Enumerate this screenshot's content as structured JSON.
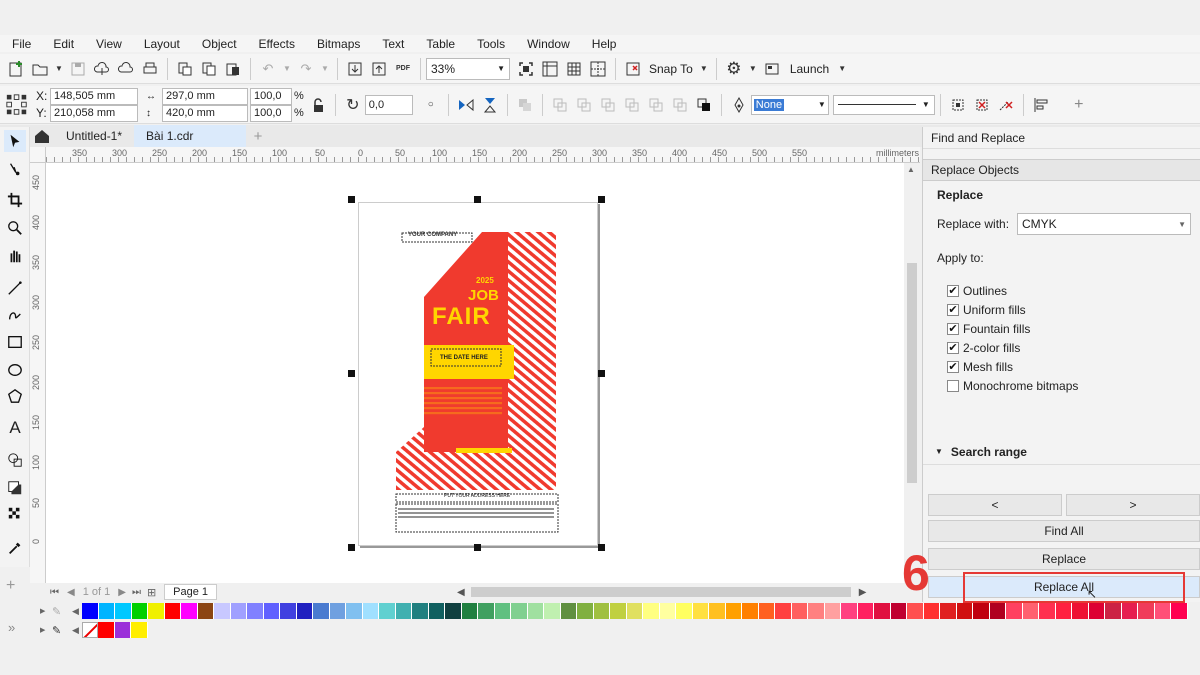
{
  "menu": [
    "File",
    "Edit",
    "View",
    "Layout",
    "Object",
    "Effects",
    "Bitmaps",
    "Text",
    "Table",
    "Tools",
    "Window",
    "Help"
  ],
  "standard_toolbar": {
    "zoom": "33%",
    "snap_to": "Snap To",
    "launch": "Launch"
  },
  "property_bar": {
    "x": "148,505 mm",
    "y": "210,058 mm",
    "width": "297,0 mm",
    "height": "420,0 mm",
    "scale_w": "100,0",
    "scale_h": "100,0",
    "pct": "%",
    "rotation": "0,0",
    "fill": "None",
    "x_label": "X:",
    "y_label": "Y:"
  },
  "tabs": [
    {
      "label": "Untitled-1*"
    },
    {
      "label": "Bài 1.cdr"
    }
  ],
  "ruler": {
    "h_ticks": [
      "350",
      "300",
      "250",
      "200",
      "150",
      "100",
      "50",
      "0",
      "50",
      "100",
      "150",
      "200",
      "250",
      "300",
      "350",
      "400",
      "450",
      "500",
      "550"
    ],
    "units": "millimeters",
    "v_ticks": [
      "450",
      "400",
      "350",
      "300",
      "250",
      "200",
      "150",
      "100",
      "50",
      "0"
    ]
  },
  "page_nav": {
    "of": "1 of 1",
    "page": "Page 1"
  },
  "panel": {
    "title": "Find and Replace",
    "section": "Replace Objects",
    "sub": "Replace",
    "replace_with_label": "Replace with:",
    "replace_with_value": "CMYK",
    "apply_to": "Apply to:",
    "options": [
      {
        "label": "Outlines",
        "checked": true
      },
      {
        "label": "Uniform fills",
        "checked": true
      },
      {
        "label": "Fountain fills",
        "checked": true
      },
      {
        "label": "2-color fills",
        "checked": true
      },
      {
        "label": "Mesh fills",
        "checked": true
      },
      {
        "label": "Monochrome bitmaps",
        "checked": false
      }
    ],
    "search_range": "Search range",
    "prev": "<",
    "next": ">",
    "find_all": "Find All",
    "replace": "Replace",
    "replace_all": "Replace All"
  },
  "step_number": "6",
  "poster": {
    "company": "YOUR COMPANY",
    "year": "2025",
    "job": "JOB",
    "fair": "FAIR",
    "date": "THE DATE HERE",
    "address": "PUT YOUR ADDRESS HERE"
  },
  "colors": {
    "accent_red": "#e53935",
    "poster_red": "#f03a2e",
    "poster_yellow": "#ffd600",
    "highlight": "#dbeafb"
  },
  "palette": [
    "#0000ff",
    "#00b4ff",
    "#00c8ff",
    "#00d000",
    "#f0f000",
    "#ff0000",
    "#ff00ff",
    "#8b4513",
    "#c8c8ff",
    "#a0a0ff",
    "#8080ff",
    "#6060ff",
    "#4040e0",
    "#2020c0",
    "#4a7bd0",
    "#6fa0e0",
    "#80c0f0",
    "#a0e0ff",
    "#60d0d0",
    "#40b0b0",
    "#208080",
    "#106060",
    "#104040",
    "#208040",
    "#40a060",
    "#60c080",
    "#80d090",
    "#a0e0a0",
    "#c0f0b0",
    "#609040",
    "#80b040",
    "#a0c040",
    "#c0d040",
    "#e0e060",
    "#ffff80",
    "#ffffa0",
    "#ffff60",
    "#ffe040",
    "#ffc020",
    "#ffa000",
    "#ff8000",
    "#ff6020",
    "#ff4040",
    "#ff6060",
    "#ff8080",
    "#ffa0a0",
    "#ff4080",
    "#ff2060",
    "#e01040",
    "#c00030",
    "#ff5050",
    "#ff3030",
    "#e02020",
    "#d01010",
    "#c00010",
    "#b00020",
    "#ff4060",
    "#ff6070",
    "#ff3050",
    "#ff2040",
    "#ee1133",
    "#dd0033",
    "#cc2244",
    "#e61e50",
    "#f03c5a",
    "#ff5078",
    "#ff0050"
  ],
  "doc_palette": [
    "#ffffff",
    "#ff0000",
    "#9b30d9",
    "#ffee00"
  ]
}
